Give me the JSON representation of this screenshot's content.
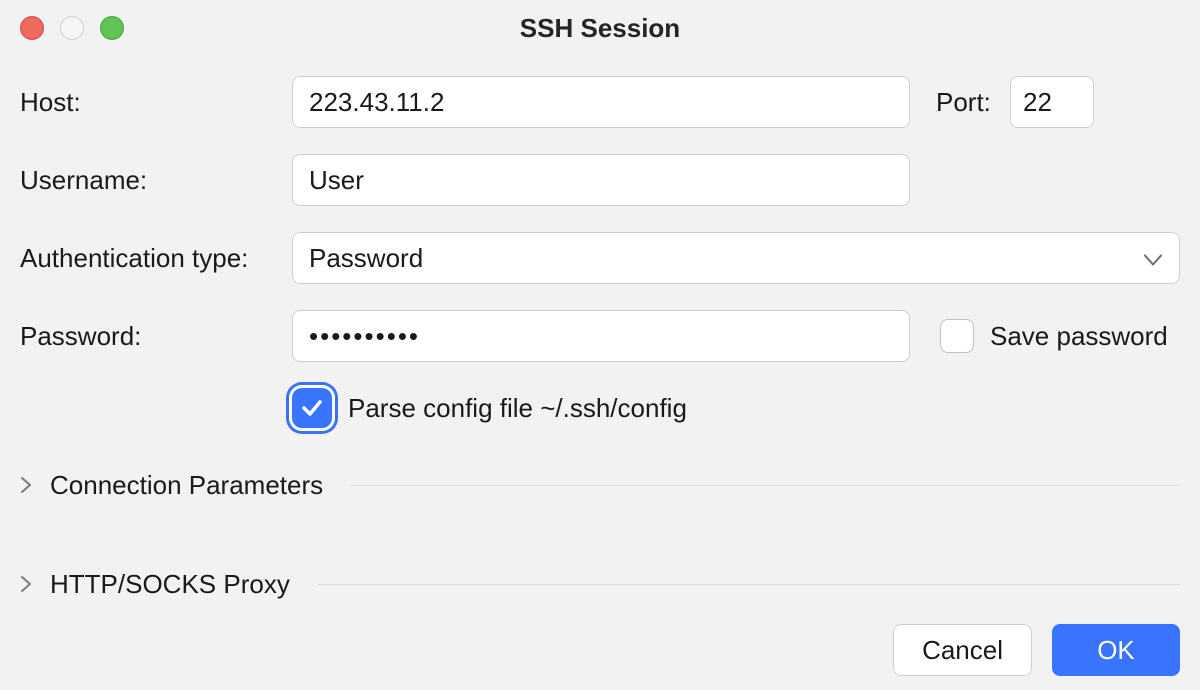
{
  "window": {
    "title": "SSH Session"
  },
  "form": {
    "host_label": "Host:",
    "host_value": "223.43.11.2",
    "port_label": "Port:",
    "port_value": "22",
    "username_label": "Username:",
    "username_value": "User",
    "auth_label": "Authentication type:",
    "auth_value": "Password",
    "password_label": "Password:",
    "password_value": "••••••••••",
    "save_password_label": "Save password",
    "save_password_checked": false,
    "parse_config_label": "Parse config file ~/.ssh/config",
    "parse_config_checked": true
  },
  "sections": {
    "connection_params": "Connection Parameters",
    "proxy": "HTTP/SOCKS Proxy"
  },
  "footer": {
    "cancel": "Cancel",
    "ok": "OK"
  }
}
